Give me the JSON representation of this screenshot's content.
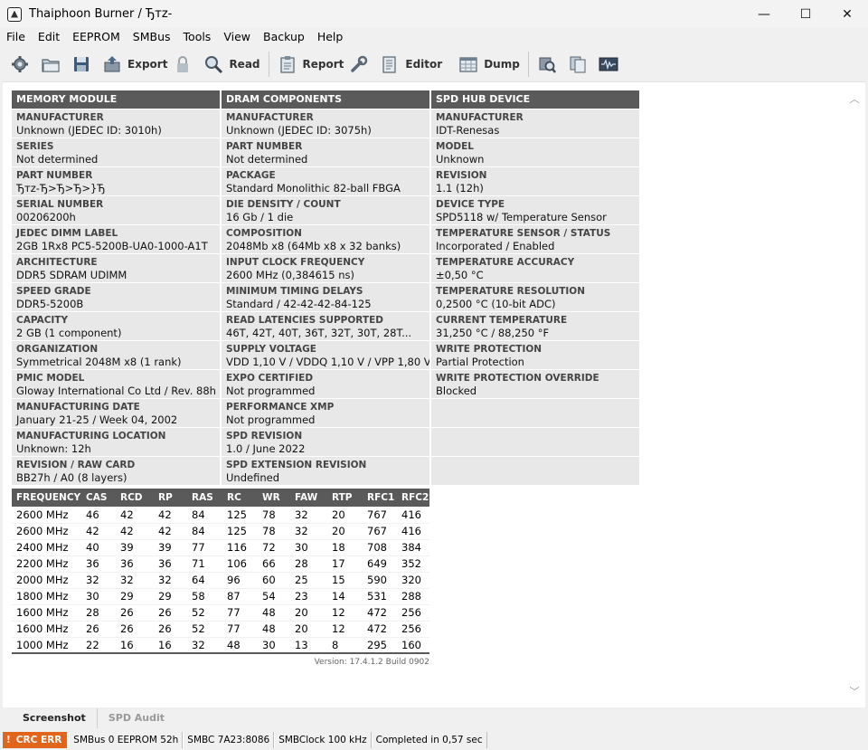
{
  "window": {
    "title": "Thaiphoon Burner / Ђтz-",
    "controls": {
      "minimize": "—",
      "maximize": "☐",
      "close": "✕"
    }
  },
  "menu": [
    "File",
    "Edit",
    "EEPROM",
    "SMBus",
    "Tools",
    "View",
    "Backup",
    "Help"
  ],
  "toolbar": {
    "export": "Export",
    "read": "Read",
    "report": "Report",
    "editor": "Editor",
    "dump": "Dump"
  },
  "spd": {
    "columns": [
      {
        "header": "MEMORY MODULE",
        "rows": [
          {
            "label": "MANUFACTURER",
            "value": "Unknown (JEDEC ID: 3010h)"
          },
          {
            "label": "SERIES",
            "value": "Not determined"
          },
          {
            "label": "PART NUMBER",
            "value": "Ђтz-Ђ>Ђ>Ђ>}Ђ"
          },
          {
            "label": "SERIAL NUMBER",
            "value": "00206200h"
          },
          {
            "label": "JEDEC DIMM LABEL",
            "value": "2GB 1Rx8 PC5-5200B-UA0-1000-A1T"
          },
          {
            "label": "ARCHITECTURE",
            "value": "DDR5 SDRAM UDIMM"
          },
          {
            "label": "SPEED GRADE",
            "value": "DDR5-5200B"
          },
          {
            "label": "CAPACITY",
            "value": "2 GB (1 component)"
          },
          {
            "label": "ORGANIZATION",
            "value": "Symmetrical 2048M x8 (1 rank)"
          },
          {
            "label": "PMIC MODEL",
            "value": "Gloway International Co Ltd / Rev. 88h"
          },
          {
            "label": "MANUFACTURING DATE",
            "value": "January 21-25 / Week 04, 2002"
          },
          {
            "label": "MANUFACTURING LOCATION",
            "value": "Unknown: 12h"
          },
          {
            "label": "REVISION / RAW CARD",
            "value": "BB27h / A0 (8 layers)"
          }
        ]
      },
      {
        "header": "DRAM COMPONENTS",
        "rows": [
          {
            "label": "MANUFACTURER",
            "value": "Unknown (JEDEC ID: 3075h)"
          },
          {
            "label": "PART NUMBER",
            "value": "Not determined"
          },
          {
            "label": "PACKAGE",
            "value": "Standard Monolithic 82-ball FBGA"
          },
          {
            "label": "DIE DENSITY / COUNT",
            "value": "16 Gb / 1 die"
          },
          {
            "label": "COMPOSITION",
            "value": "2048Mb x8 (64Mb x8 x 32 banks)"
          },
          {
            "label": "INPUT CLOCK FREQUENCY",
            "value": "2600 MHz (0,384615 ns)"
          },
          {
            "label": "MINIMUM TIMING DELAYS",
            "value": "Standard / 42-42-42-84-125"
          },
          {
            "label": "READ LATENCIES SUPPORTED",
            "value": "46T, 42T, 40T, 36T, 32T, 30T, 28T..."
          },
          {
            "label": "SUPPLY VOLTAGE",
            "value": "VDD 1,10 V / VDDQ 1,10 V / VPP 1,80 V"
          },
          {
            "label": "EXPO CERTIFIED",
            "value": "Not programmed"
          },
          {
            "label": "PERFORMANCE XMP",
            "value": "Not programmed"
          },
          {
            "label": "SPD REVISION",
            "value": "1.0 / June 2022"
          },
          {
            "label": "SPD EXTENSION REVISION",
            "value": "Undefined"
          }
        ]
      },
      {
        "header": "SPD HUB DEVICE",
        "rows": [
          {
            "label": "MANUFACTURER",
            "value": "IDT-Renesas"
          },
          {
            "label": "MODEL",
            "value": "Unknown"
          },
          {
            "label": "REVISION",
            "value": "1.1 (12h)"
          },
          {
            "label": "DEVICE TYPE",
            "value": "SPD5118 w/ Temperature Sensor"
          },
          {
            "label": "TEMPERATURE SENSOR / STATUS",
            "value": "Incorporated / Enabled"
          },
          {
            "label": "TEMPERATURE ACCURACY",
            "value": "±0,50 °C"
          },
          {
            "label": "TEMPERATURE RESOLUTION",
            "value": "0,2500 °C (10-bit ADC)"
          },
          {
            "label": "CURRENT TEMPERATURE",
            "value": "31,250 °C / 88,250 °F"
          },
          {
            "label": "WRITE PROTECTION",
            "value": "Partial Protection"
          },
          {
            "label": "WRITE PROTECTION OVERRIDE",
            "value": "Blocked"
          }
        ]
      }
    ]
  },
  "timings": {
    "headers": [
      "FREQUENCY",
      "CAS",
      "RCD",
      "RP",
      "RAS",
      "RC",
      "WR",
      "FAW",
      "RTP",
      "RFC1",
      "RFC2"
    ],
    "rows": [
      [
        "2600 MHz",
        "46",
        "42",
        "42",
        "84",
        "125",
        "78",
        "32",
        "20",
        "767",
        "416"
      ],
      [
        "2600 MHz",
        "42",
        "42",
        "42",
        "84",
        "125",
        "78",
        "32",
        "20",
        "767",
        "416"
      ],
      [
        "2400 MHz",
        "40",
        "39",
        "39",
        "77",
        "116",
        "72",
        "30",
        "18",
        "708",
        "384"
      ],
      [
        "2200 MHz",
        "36",
        "36",
        "36",
        "71",
        "106",
        "66",
        "28",
        "17",
        "649",
        "352"
      ],
      [
        "2000 MHz",
        "32",
        "32",
        "32",
        "64",
        "96",
        "60",
        "25",
        "15",
        "590",
        "320"
      ],
      [
        "1800 MHz",
        "30",
        "29",
        "29",
        "58",
        "87",
        "54",
        "23",
        "14",
        "531",
        "288"
      ],
      [
        "1600 MHz",
        "28",
        "26",
        "26",
        "52",
        "77",
        "48",
        "20",
        "12",
        "472",
        "256"
      ],
      [
        "1600 MHz",
        "26",
        "26",
        "26",
        "52",
        "77",
        "48",
        "20",
        "12",
        "472",
        "256"
      ],
      [
        "1000 MHz",
        "22",
        "16",
        "16",
        "32",
        "48",
        "30",
        "13",
        "8",
        "295",
        "160"
      ]
    ]
  },
  "version": "Version: 17.4.1.2 Build 0902",
  "tabs": {
    "screenshot": "Screenshot",
    "spd_audit": "SPD Audit"
  },
  "status": {
    "error": "CRC ERR",
    "smbus": "SMBus 0 EEPROM 52h",
    "smbc": "SMBC 7A23:8086",
    "clock": "SMBClock 100 kHz",
    "completed": "Completed in 0,57 sec"
  },
  "colors": {
    "header_bg": "#5a5a5a",
    "cell_bg": "#e8e8e8",
    "error_bg": "#e1661b"
  }
}
